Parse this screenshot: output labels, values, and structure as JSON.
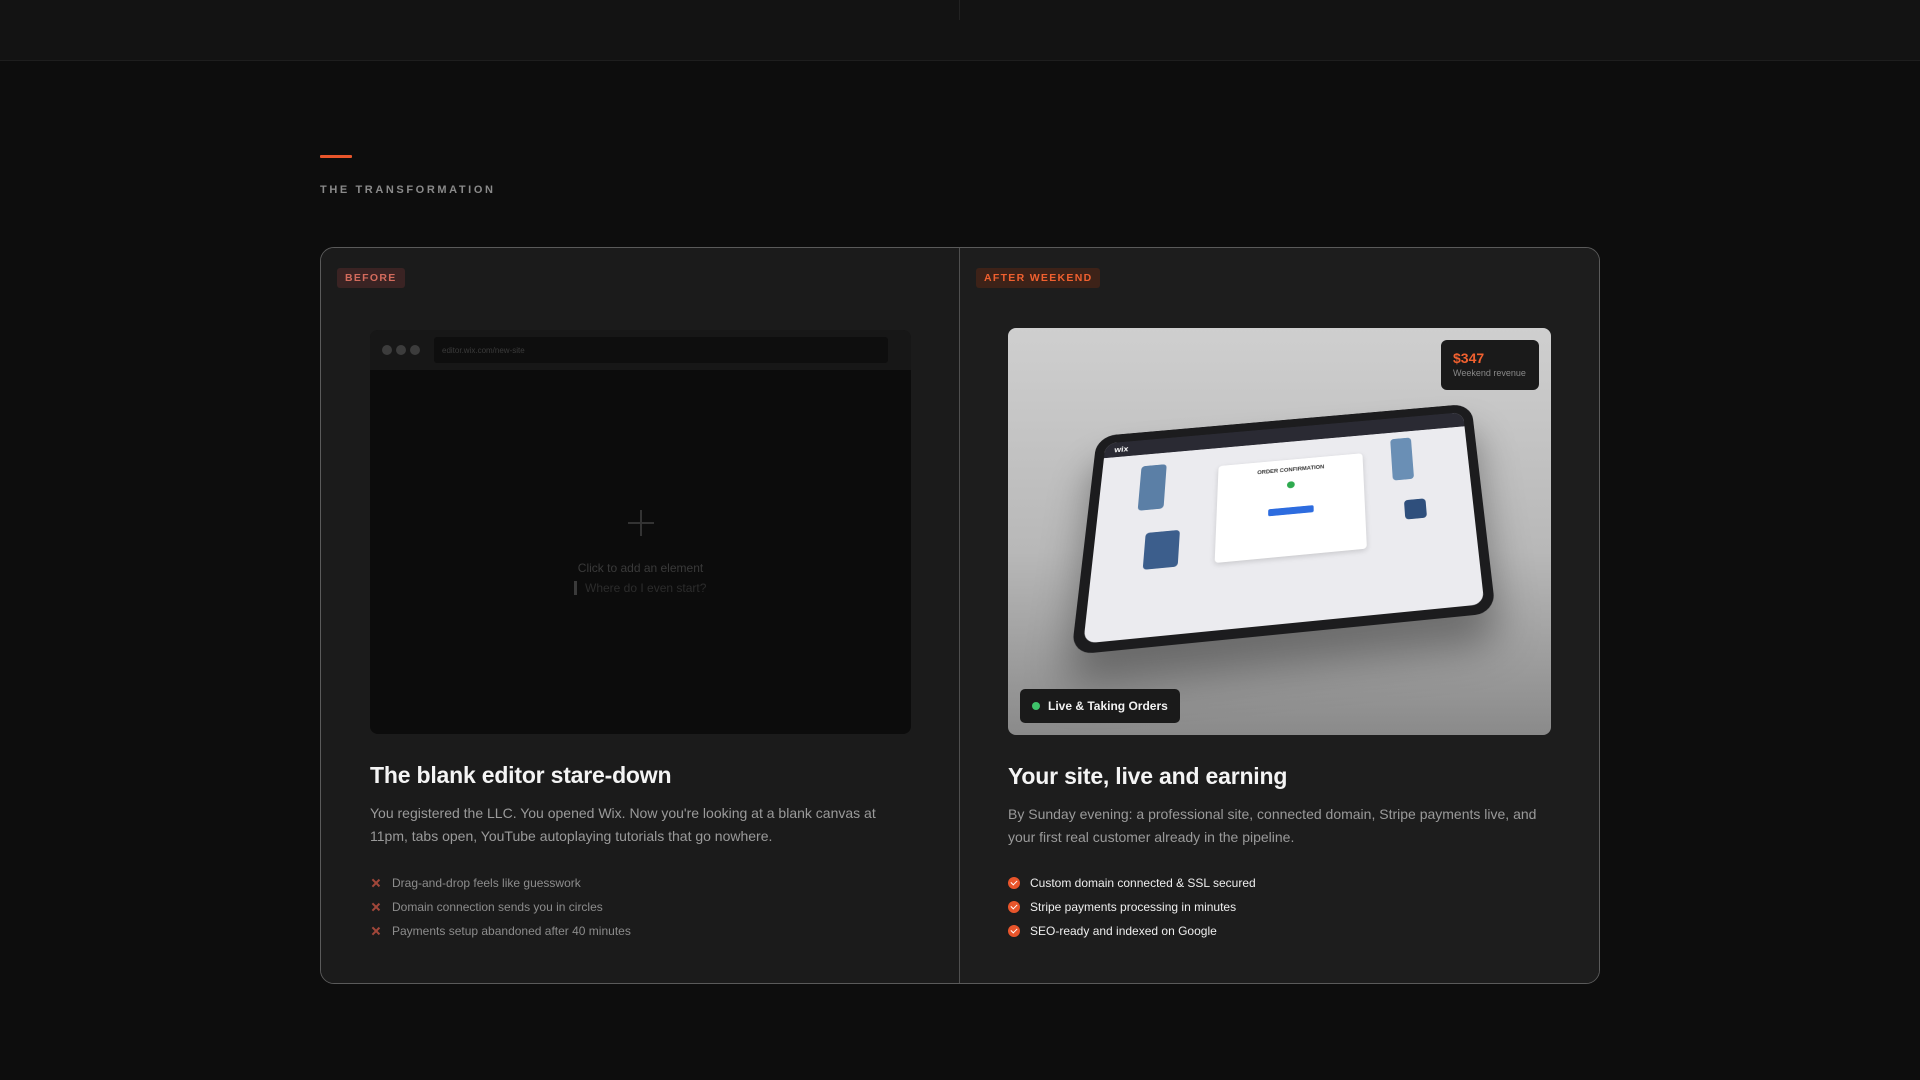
{
  "section": {
    "eyebrow": "THE TRANSFORMATION"
  },
  "before": {
    "tag": "BEFORE",
    "url": "editor.wix.com/new-site",
    "canvas_hint": "Click to add an element",
    "canvas_prompt": "Where do I even start?",
    "title": "The blank editor stare-down",
    "description": "You registered the LLC. You opened Wix. Now you're looking at a blank canvas at 11pm, tabs open, YouTube autoplaying tutorials that go nowhere.",
    "items": [
      "Drag-and-drop feels like guesswork",
      "Domain connection sends you in circles",
      "Payments setup abandoned after 40 minutes"
    ]
  },
  "after": {
    "tag": "AFTER WEEKEND",
    "revenue_amount": "$347",
    "revenue_label": "Weekend revenue",
    "tablet_brand": "wix",
    "order_title": "ORDER CONFIRMATION",
    "live_status": "Live & Taking Orders",
    "title": "Your site, live and earning",
    "description": "By Sunday evening: a professional site, connected domain, Stripe payments live, and your first real customer already in the pipeline.",
    "items": [
      "Custom domain connected & SSL secured",
      "Stripe payments processing in minutes",
      "SEO-ready and indexed on Google"
    ]
  },
  "colors": {
    "accent": "#e8552b",
    "live": "#3ec26a"
  }
}
